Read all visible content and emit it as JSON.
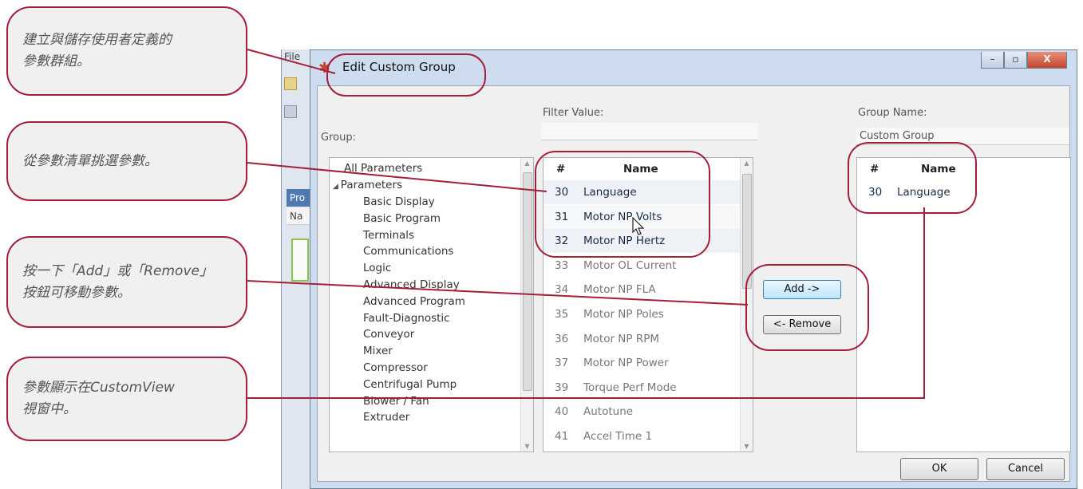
{
  "callouts": {
    "c1": [
      "建立與儲存使用者定義的",
      "參數群組。"
    ],
    "c2": [
      "從參數清單挑選參數。"
    ],
    "c3": [
      "按一下「Add」或「Remove」",
      "按鈕可移動參數。"
    ],
    "c4": [
      "參數顯示在CustomView",
      "視窗中。"
    ]
  },
  "background_app": {
    "menu": "File",
    "panel": "Pro",
    "column": "Na"
  },
  "dialog": {
    "title": "Edit Custom Group",
    "window_buttons": {
      "minimize": "–",
      "maximize": "▫",
      "close": "X"
    },
    "group_label": "Group:",
    "filter_label": "Filter Value:",
    "filter_value": "",
    "group_name_label": "Group Name:",
    "group_name_value": "Custom Group",
    "tree": {
      "root": "All Parameters",
      "parent": "Parameters",
      "children": [
        "Basic Display",
        "Basic Program",
        "Terminals",
        "Communications",
        "Logic",
        "Advanced Display",
        "Advanced Program",
        "Fault-Diagnostic",
        "Conveyor",
        "Mixer",
        "Compressor",
        "Centrifugal Pump",
        "Blower / Fan",
        "Extruder"
      ]
    },
    "param_list": {
      "headers": {
        "num": "#",
        "name": "Name"
      },
      "rows": [
        {
          "num": "30",
          "name": "Language"
        },
        {
          "num": "31",
          "name": "Motor NP Volts"
        },
        {
          "num": "32",
          "name": "Motor NP Hertz"
        },
        {
          "num": "33",
          "name": "Motor OL Current"
        },
        {
          "num": "34",
          "name": "Motor NP FLA"
        },
        {
          "num": "35",
          "name": "Motor NP Poles"
        },
        {
          "num": "36",
          "name": "Motor NP RPM"
        },
        {
          "num": "37",
          "name": "Motor NP Power"
        },
        {
          "num": "39",
          "name": "Torque Perf Mode"
        },
        {
          "num": "40",
          "name": "Autotune"
        },
        {
          "num": "41",
          "name": "Accel Time 1"
        }
      ]
    },
    "add_button": "Add ->",
    "remove_button": "<- Remove",
    "group_list": {
      "headers": {
        "num": "#",
        "name": "Name"
      },
      "rows": [
        {
          "num": "30",
          "name": "Language"
        }
      ]
    },
    "ok_button": "OK",
    "cancel_button": "Cancel"
  },
  "colors": {
    "callout_border": "#a3203a",
    "dialog_frame": "#cdddef",
    "default_button": "#bee6fd"
  }
}
